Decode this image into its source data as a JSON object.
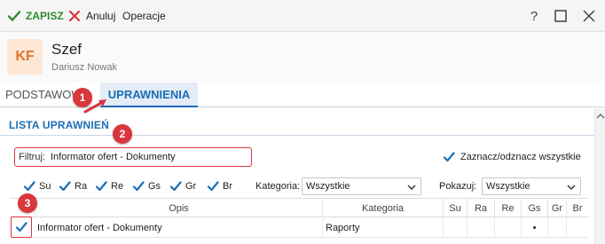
{
  "toolbar": {
    "save_label": "ZAPISZ",
    "cancel_label": "Anuluj",
    "operations_label": "Operacje"
  },
  "header": {
    "avatar_initials": "KF",
    "title": "Szef",
    "subtitle": "Dariusz Nowak"
  },
  "tabs": [
    {
      "label": "PODSTAWOWE"
    },
    {
      "label": "UPRAWNIENIA",
      "active": true
    }
  ],
  "section": {
    "title": "LISTA UPRAWNIEŃ"
  },
  "filter": {
    "label": "Filtruj:",
    "value": "Informator ofert - Dokumenty"
  },
  "toggle_all": {
    "label": "Zaznacz/odznacz wszystkie",
    "checked": true
  },
  "rights": [
    {
      "label": "Su",
      "checked": true
    },
    {
      "label": "Ra",
      "checked": true
    },
    {
      "label": "Re",
      "checked": true
    },
    {
      "label": "Gs",
      "checked": true
    },
    {
      "label": "Gr",
      "checked": true
    },
    {
      "label": "Br",
      "checked": true
    }
  ],
  "category_filter": {
    "label": "Kategoria:",
    "value": "Wszystkie"
  },
  "show_filter": {
    "label": "Pokazuj:",
    "value": "Wszystkie"
  },
  "table": {
    "columns": [
      "Opis",
      "Kategoria",
      "Su",
      "Ra",
      "Re",
      "Gs",
      "Gr",
      "Br"
    ],
    "rows": [
      {
        "checked": true,
        "opis": "Informator ofert - Dokumenty",
        "kategoria": "Raporty",
        "su": "",
        "ra": "",
        "re": "",
        "gs": "•",
        "gr": "",
        "br": ""
      }
    ]
  },
  "markers": [
    "1",
    "2",
    "3"
  ],
  "colors": {
    "accent": "#1a6eb4",
    "save_green": "#2f8a2f",
    "cancel_red": "#d9363e",
    "avatar_text": "#e6732a",
    "avatar_bg": "#fde7d6",
    "marker_red": "#d9363e"
  }
}
